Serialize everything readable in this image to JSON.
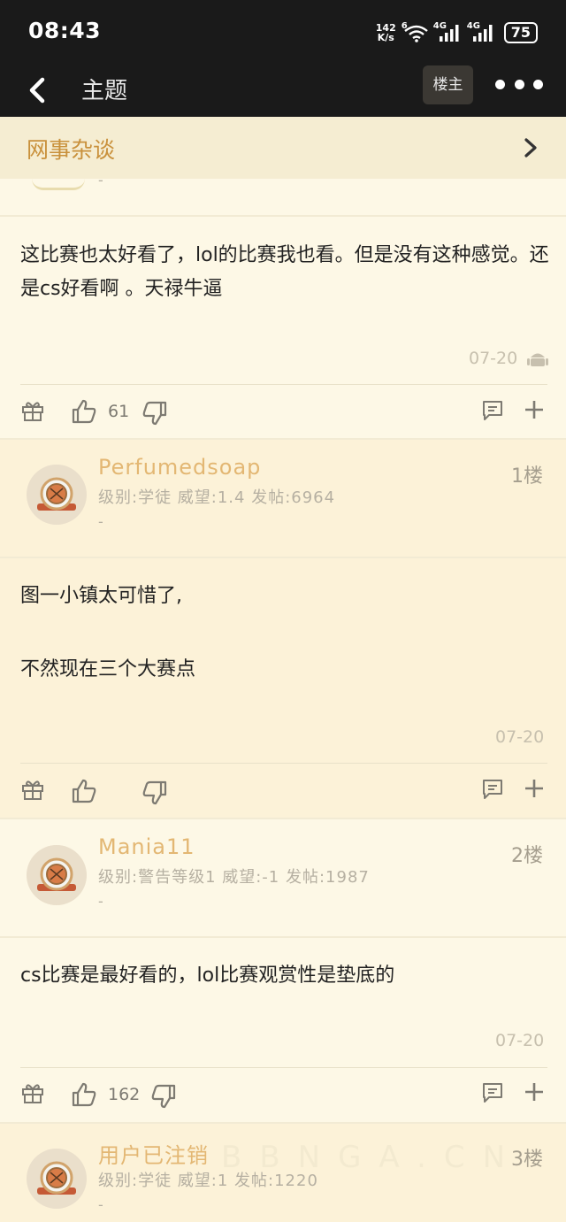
{
  "status_bar": {
    "time": "08:43",
    "net_speed_value": "142",
    "net_speed_unit": "K/s",
    "wifi_badge": "6",
    "sim1": "4G",
    "sim2": "4G",
    "battery": "75"
  },
  "topbar": {
    "title": "主题",
    "op_button": "楼主",
    "back_icon": "chevron-left-icon",
    "more_icon": "more-dots-icon"
  },
  "board": {
    "name": "网事杂谈",
    "arrow_icon": "chevron-right-icon"
  },
  "first_post": {
    "sig": "-",
    "text": "这比赛也太好看了，lol的比赛我也看。但是没有这种感觉。还是cs好看啊 。天禄牛逼",
    "date": "07-20",
    "platform_icon": "android-icon",
    "likes": "61"
  },
  "replies": [
    {
      "username": "Perfumedsoap",
      "info": "级别:学徒 威望:1.4 发帖:6964",
      "sig": "-",
      "floor": "1楼",
      "text_lines": [
        "图一小镇太可惜了,",
        "不然现在三个大赛点"
      ],
      "date": "07-20",
      "likes": ""
    },
    {
      "username": "Mania11",
      "info": "级别:警告等级1 威望:-1 发帖:1987",
      "sig": "-",
      "floor": "2楼",
      "text_lines": [
        "cs比赛是最好看的，lol比赛观赏性是垫底的"
      ],
      "date": "07-20",
      "likes": "162"
    },
    {
      "username": "用户已注销",
      "info": "级别:学徒 威望:1 发帖:1220",
      "sig": "-",
      "floor": "3楼"
    }
  ],
  "colors": {
    "bar": "#1a1a1a",
    "accent": "#c9913c",
    "username": "#e3b773",
    "reply_bg": "#fcf2d8",
    "page_bg": "#fdf8e6"
  },
  "watermark": "BBNGA.CN"
}
